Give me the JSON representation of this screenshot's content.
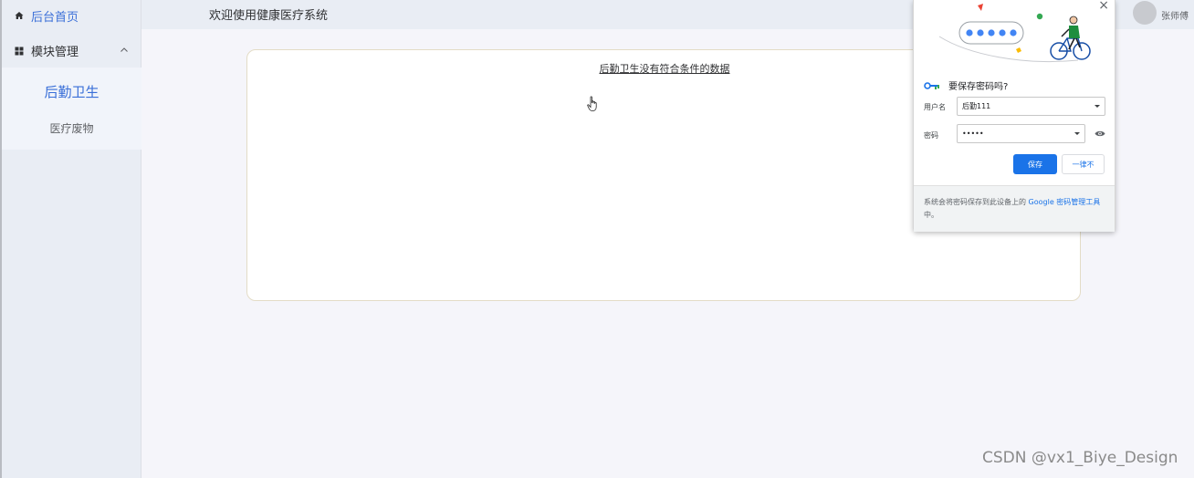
{
  "sidebar": {
    "home_label": "后台首页",
    "module_label": "模块管理",
    "sub_items": [
      {
        "label": "后勤卫生",
        "active": true
      },
      {
        "label": "医疗废物",
        "active": false
      }
    ]
  },
  "header": {
    "welcome": "欢迎使用健康医疗系统",
    "username": "张师傅"
  },
  "content": {
    "empty_message": "后勤卫生没有符合条件的数据"
  },
  "password_popup": {
    "title": "要保存密码吗?",
    "username_label": "用户名",
    "username_value": "后勤111",
    "password_label": "密码",
    "password_value": "•••••",
    "save_label": "保存",
    "never_label": "一律不",
    "footer_prefix": "系统会将密码保存到此设备上的 ",
    "footer_link": "Google 密码管理工具",
    "footer_suffix": "中。",
    "close_symbol": "×"
  },
  "watermark": "CSDN @vx1_Biye_Design",
  "colors": {
    "accent": "#3a6fd8",
    "google_blue": "#1a73e8"
  }
}
